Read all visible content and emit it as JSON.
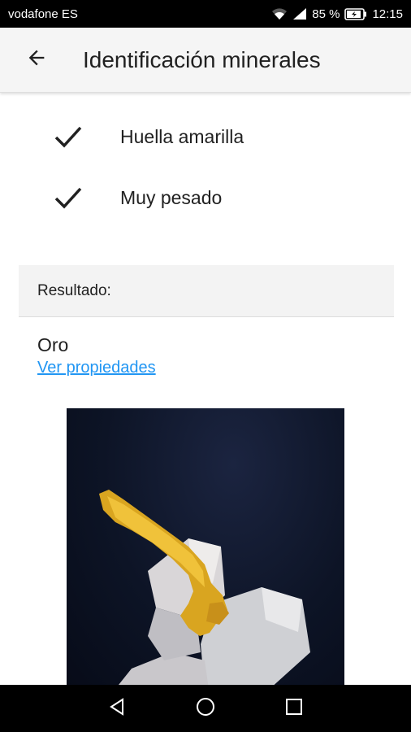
{
  "status_bar": {
    "carrier": "vodafone ES",
    "battery": "85 %",
    "time": "12:15",
    "icons": [
      "wifi-icon",
      "signal-icon",
      "battery-charging-icon"
    ]
  },
  "app_bar": {
    "back_icon": "arrow-back-icon",
    "title": "Identificación minerales"
  },
  "checks": [
    {
      "icon": "check-icon",
      "label": "Huella amarilla"
    },
    {
      "icon": "check-icon",
      "label": "Muy pesado"
    }
  ],
  "result": {
    "header": "Resultado:",
    "mineral": "Oro",
    "link": "Ver propiedades"
  },
  "image": {
    "subject": "gold-on-quartz-photo"
  },
  "nav_bar": {
    "icons": [
      "nav-back-icon",
      "nav-home-icon",
      "nav-recents-icon"
    ]
  }
}
